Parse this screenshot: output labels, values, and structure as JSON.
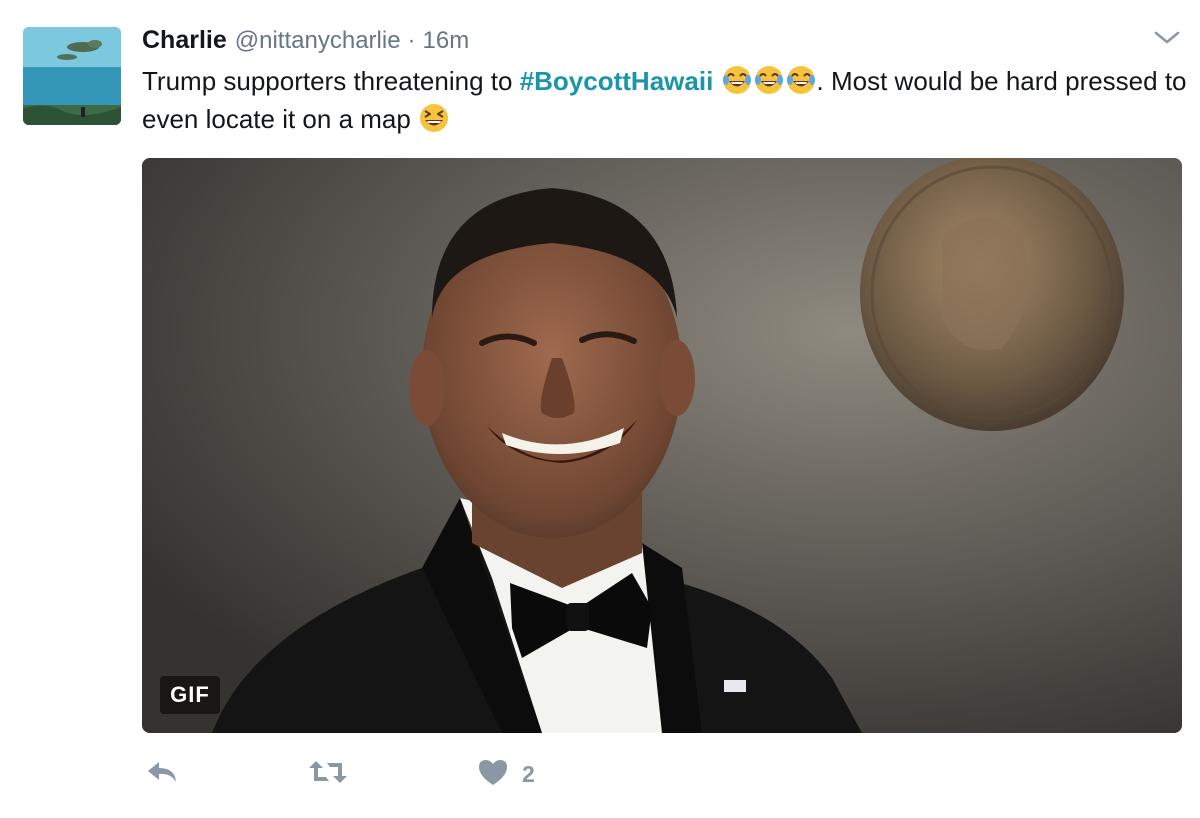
{
  "tweet": {
    "display_name": "Charlie",
    "handle": "@nittanycharlie",
    "separator": "·",
    "time": "16m",
    "text_part1": "Trump supporters threatening to ",
    "hashtag": "#BoycottHawaii",
    "text_part2": ". Most would be hard pressed to even locate it on a map",
    "media_badge": "GIF",
    "like_count": "2"
  },
  "icons": {
    "caret": "chevron-down-icon",
    "reply": "reply-icon",
    "retweet": "retweet-icon",
    "like": "heart-icon",
    "emoji_laugh": "tears-of-joy-emoji",
    "emoji_grin": "grinning-squinting-emoji"
  },
  "colors": {
    "hashtag": "#1b95a8",
    "name": "#14171a",
    "meta": "#657786",
    "action": "#8b97a4"
  }
}
